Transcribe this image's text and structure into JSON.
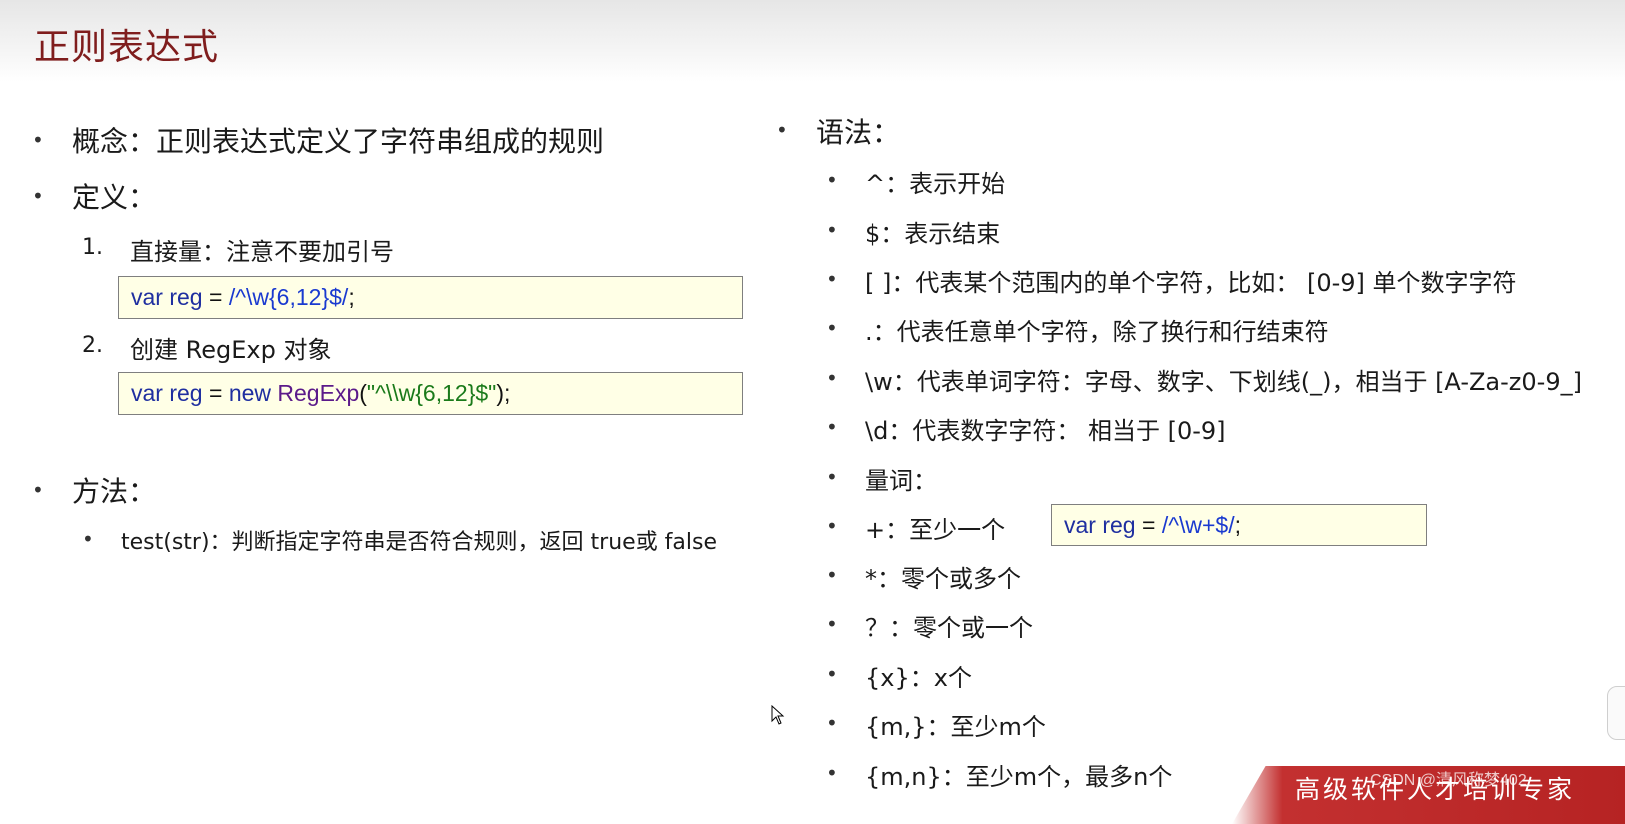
{
  "title": "正则表达式",
  "left": {
    "concept": "概念：正则表达式定义了字符串组成的规则",
    "definition_heading": "定义：",
    "def_items": [
      {
        "num": "1.",
        "label": "直接量：注意不要加引号"
      },
      {
        "num": "2.",
        "label": "创建 RegExp 对象"
      }
    ],
    "code1": {
      "kw": "var",
      "ident": " reg ",
      "eq": "= ",
      "regex": "/^\\w{6,12}$/",
      "end": ";"
    },
    "code2": {
      "kw": "var",
      "ident": " reg ",
      "eq": "= ",
      "new": "new ",
      "fn": "RegExp",
      "open": "(",
      "str": "\"^\\\\w{6,12}$\"",
      "close": ");"
    },
    "methods_heading": "方法：",
    "method_item": "test(str)：判断指定字符串是否符合规则，返回 true或 false"
  },
  "right": {
    "syntax_heading": "语法：",
    "items": [
      "^：表示开始",
      "$：表示结束",
      "[ ]：代表某个范围内的单个字符，比如： [0-9] 单个数字字符",
      ".：代表任意单个字符，除了换行和行结束符",
      "\\w：代表单词字符：字母、数字、下划线(_)，相当于 [A-Za-z0-9_]",
      "\\d：代表数字字符： 相当于 [0-9]",
      "量词：",
      "+：至少一个",
      "*：零个或多个",
      "？：零个或一个",
      "{x}：x个",
      "{m,}：至少m个",
      "{m,n}：至少m个，最多n个"
    ],
    "code3": {
      "kw": "var",
      "ident": " reg ",
      "eq": "= ",
      "regex": "/^\\w+$/",
      "end": ";"
    }
  },
  "bullet_symbol": "•",
  "footer": {
    "text": "高级软件人才培训专家",
    "watermark": "CSDN @清风称梦402"
  },
  "colors": {
    "title": "#7f1d1d",
    "code_bg": "#ffffe6",
    "keyword": "#1f2fa0",
    "function": "#5b1a8a",
    "string": "#1a7a1a",
    "footer_band": "#b52222"
  },
  "icons": [
    "mouse-pointer-icon"
  ]
}
